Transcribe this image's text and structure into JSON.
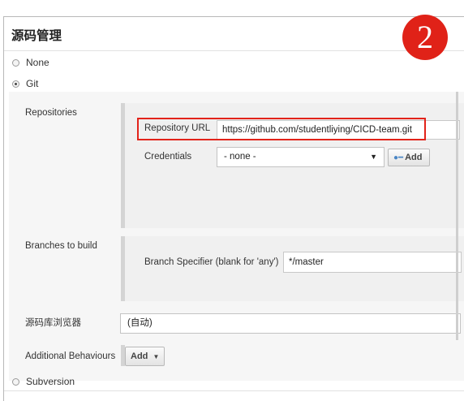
{
  "section": {
    "title": "源码管理"
  },
  "scm_options": [
    {
      "label": "None",
      "selected": false
    },
    {
      "label": "Git",
      "selected": true
    }
  ],
  "subversion_option": {
    "label": "Subversion",
    "selected": false
  },
  "repositories": {
    "label": "Repositories",
    "url_label": "Repository URL",
    "url_value": "https://github.com/studentliying/CICD-team.git",
    "credentials_label": "Credentials",
    "credentials_value": "- none -",
    "add_label": "Add"
  },
  "branches": {
    "label": "Branches to build",
    "specifier_label": "Branch Specifier (blank for 'any')",
    "specifier_value": "*/master"
  },
  "browser": {
    "label": "源码库浏览器",
    "value": "(自动)"
  },
  "behaviours": {
    "label": "Additional Behaviours",
    "add_label": "Add"
  },
  "badge": {
    "number": "2",
    "color": "#e02218"
  },
  "highlight_color": "#e2231a",
  "icons": {
    "credentials_add": "key-icon",
    "dropdown": "caret-down-icon"
  }
}
